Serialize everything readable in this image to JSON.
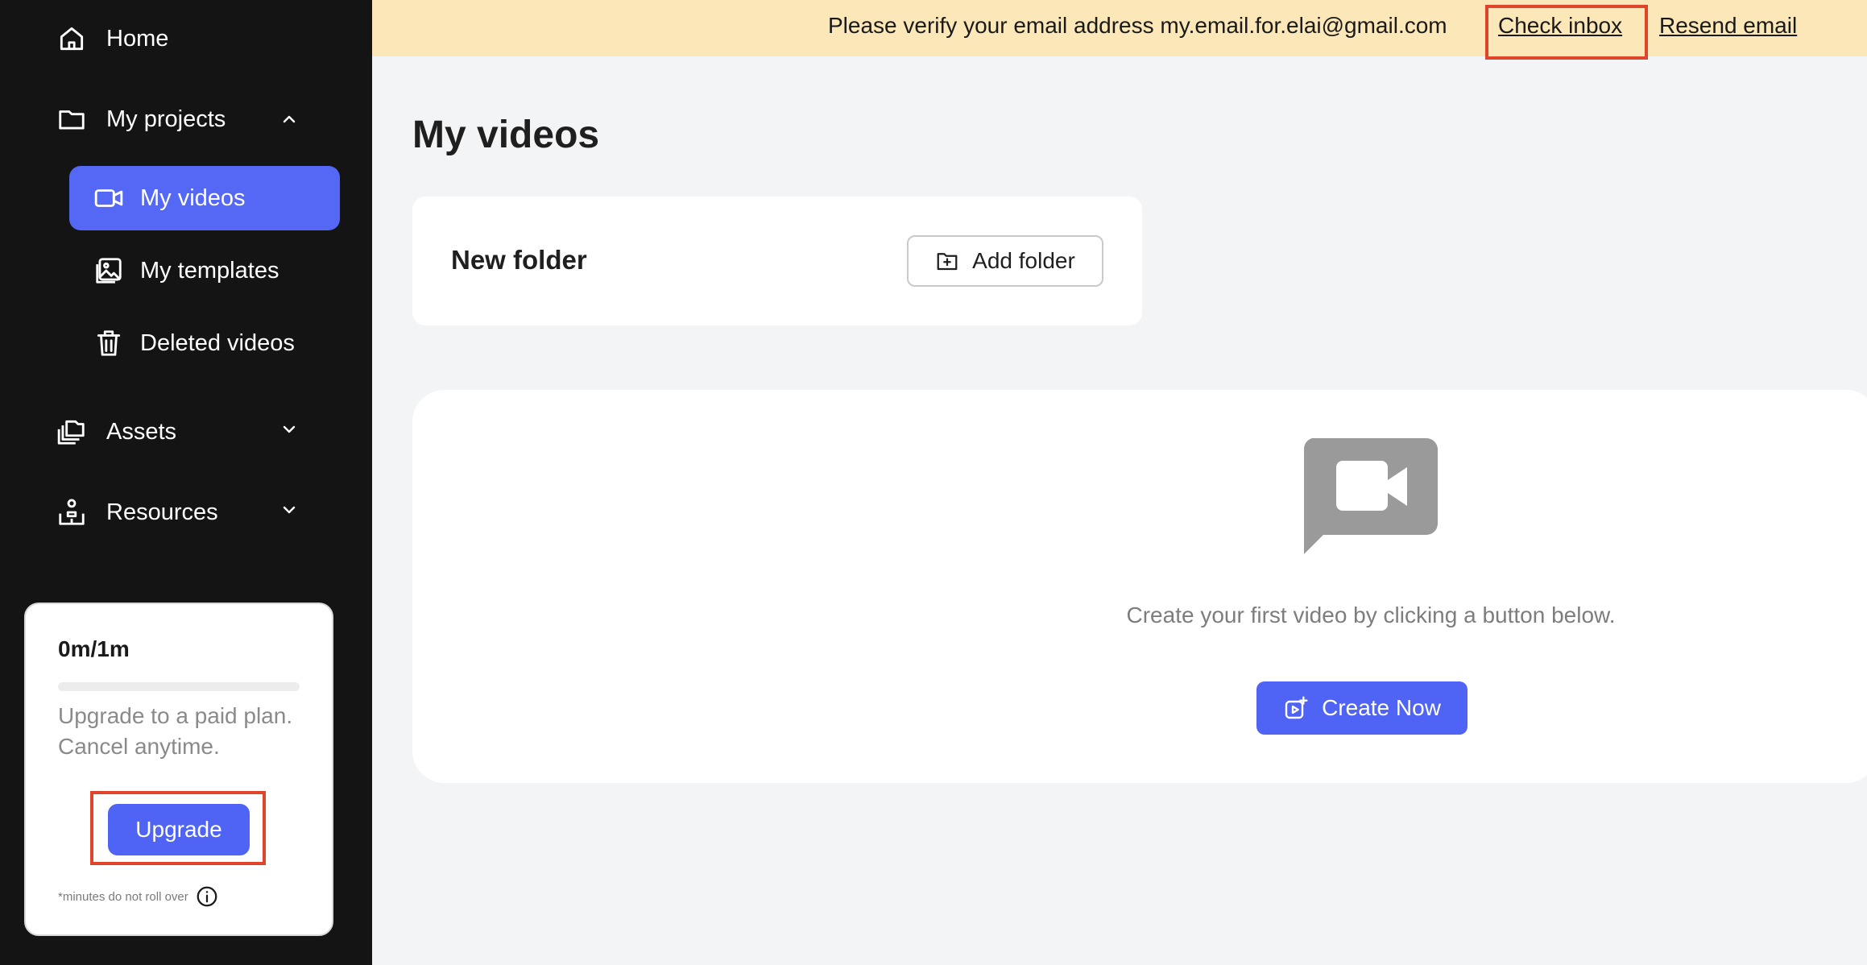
{
  "sidebar": {
    "home": "Home",
    "my_projects": "My projects",
    "my_videos": "My videos",
    "my_templates": "My templates",
    "deleted_videos": "Deleted videos",
    "assets": "Assets",
    "resources": "Resources"
  },
  "usage": {
    "minutes": "0m/1m",
    "progress_percent": 0,
    "description": "Upgrade to a paid plan. Cancel anytime.",
    "upgrade_label": "Upgrade",
    "note": "*minutes do not roll over"
  },
  "banner": {
    "message": "Please verify your email address my.email.for.elai@gmail.com",
    "check_inbox": "Check inbox",
    "resend_email": "Resend email"
  },
  "main": {
    "title": "My videos",
    "folder_title": "New folder",
    "add_folder_label": "Add folder",
    "empty_message": "Create your first video by clicking a button below.",
    "create_label": "Create Now"
  },
  "colors": {
    "sidebar_bg": "#141414",
    "accent": "#4f63f5",
    "banner_bg": "#fbe7b8",
    "highlight": "#e0452b"
  }
}
